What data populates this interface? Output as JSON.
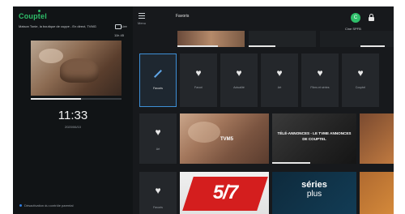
{
  "colors": {
    "brand": "#2fbf6a",
    "accent": "#3e8fd6",
    "background": "#0d0f11"
  },
  "left_panel": {
    "brand": "Couptel",
    "now_playing_title": "Maison Tonie, la boutique de cuppe - En direct, TVMG",
    "now_playing_side": "Lire",
    "now_playing_time": "11h 45",
    "progress_fraction": 0.55,
    "clock": "11:33",
    "date": "2020/06/10",
    "parental_label": "Désactivation du contrôle parental"
  },
  "header": {
    "menu_label": "Menu",
    "title": "Favoris",
    "avatar_initial": "C",
    "user_name": "Cine SPFB"
  },
  "categories": [
    {
      "label": "Favoris",
      "icon": "pencil-icon",
      "selected": true
    },
    {
      "label": "Favori",
      "icon": "heart-icon"
    },
    {
      "label": "Actualité",
      "icon": "heart-icon"
    },
    {
      "label": "Art",
      "icon": "heart-icon"
    },
    {
      "label": "Films et séries",
      "icon": "heart-icon"
    },
    {
      "label": "Couptel",
      "icon": "heart-icon"
    }
  ],
  "row2_category": {
    "label": "Art",
    "icon": "heart-icon"
  },
  "row3_category": {
    "label": "Favoris",
    "icon": "heart-icon"
  },
  "tiles": {
    "tvm5": "TVM5",
    "announcement": "TÉLÉ-ANNONCES - LE TVME ANNONCES DE COUPTEL",
    "channel_57": "5/7",
    "series_plus_line1": "séries",
    "series_plus_line2": "plus"
  }
}
